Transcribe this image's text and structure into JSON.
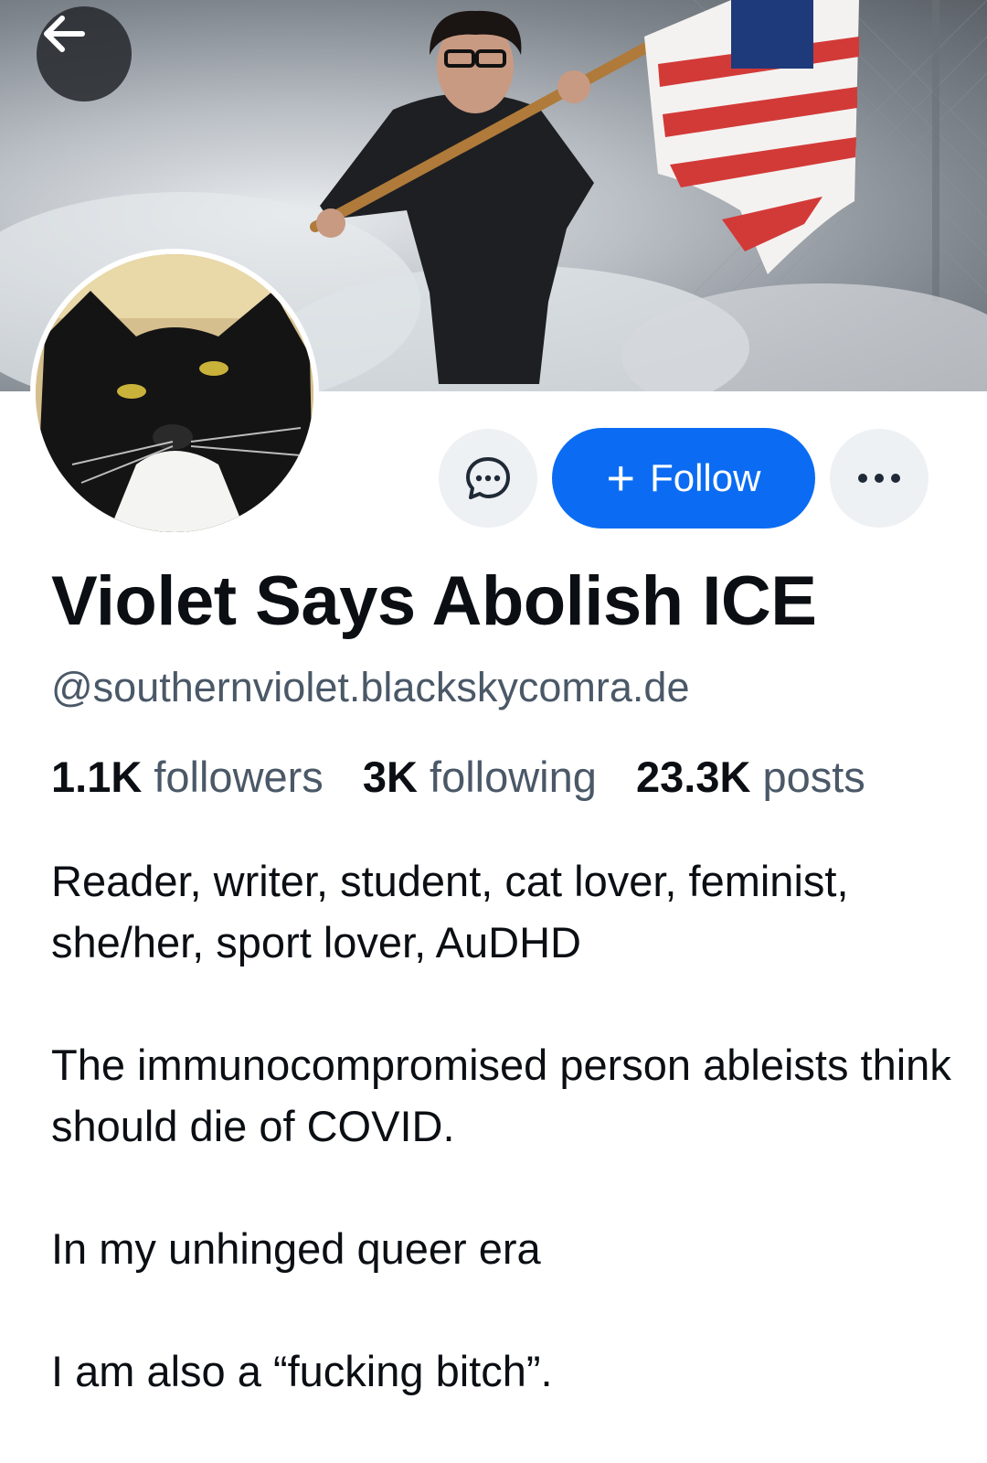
{
  "profile": {
    "display_name": "Violet Says Abolish ICE",
    "handle": "@southernviolet.blackskycomra.de",
    "stats": {
      "followers_count": "1.1K",
      "followers_label": "followers",
      "following_count": "3K",
      "following_label": "following",
      "posts_count": "23.3K",
      "posts_label": "posts"
    },
    "bio": [
      "Reader, writer, student, cat lover, feminist, she/her, sport lover, AuDHD",
      "The immunocompromised person ableists think should die of COVID.",
      "In my unhinged queer era",
      "I am also a “fucking bitch”."
    ]
  },
  "actions": {
    "follow_plus": "+",
    "follow_label": "Follow"
  },
  "icons": {
    "back": "arrow-left-icon",
    "message": "chat-bubble-icon",
    "more": "ellipsis-icon"
  },
  "colors": {
    "accent": "#0b6cf3",
    "secondary_text": "#4a5867",
    "button_bg": "#eef1f4"
  }
}
